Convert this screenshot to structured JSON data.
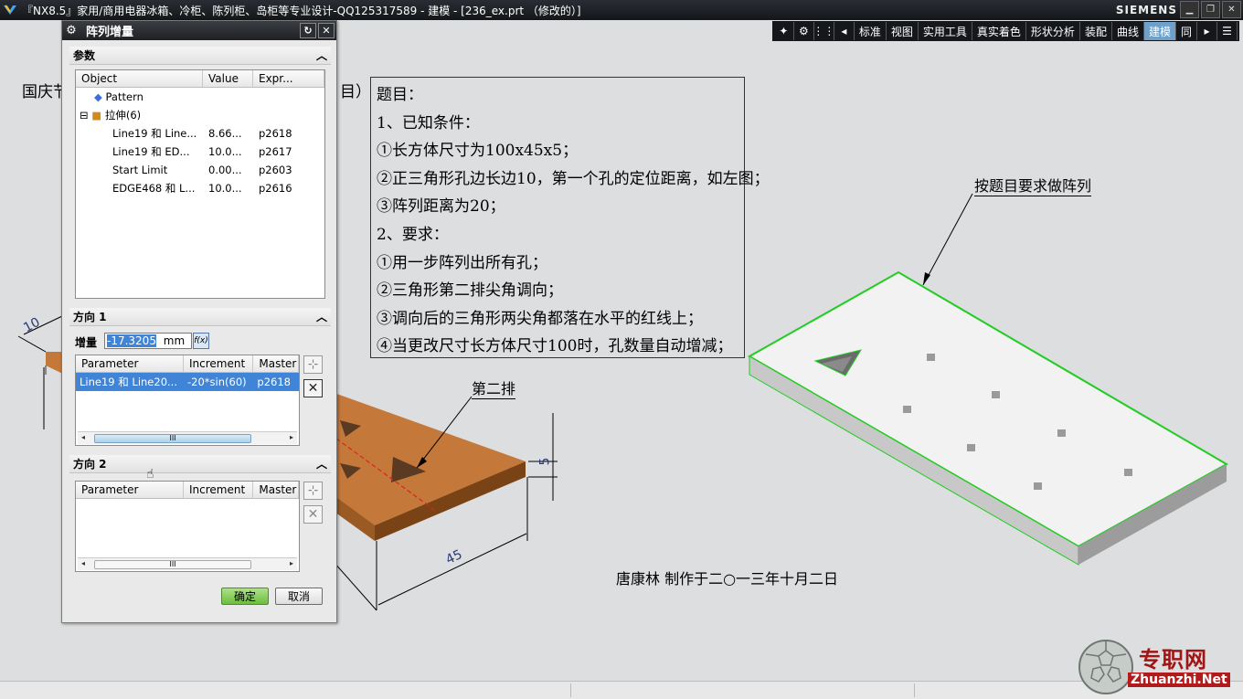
{
  "window": {
    "title": "『NX8.5』家用/商用电器冰箱、冷柜、陈列柜、岛柜等专业设计-QQ125317589 - 建模 - [236_ex.prt （修改的）]",
    "brand": "SIEMENS",
    "min": "▁",
    "restore": "❐",
    "close": "✕"
  },
  "toolbar": {
    "items": [
      "标准",
      "视图",
      "实用工具",
      "真实着色",
      "形状分析",
      "装配",
      "曲线",
      "建模",
      "同"
    ],
    "active": "建模"
  },
  "dialog": {
    "title": "阵列增量",
    "reset": "↻",
    "close": "✕",
    "params_label": "参数",
    "grid1": {
      "headers": [
        "Object",
        "Value",
        "Expr..."
      ],
      "rows": [
        {
          "object": "Pattern",
          "value": "",
          "expr": ""
        },
        {
          "object": "拉伸(6)",
          "value": "",
          "expr": ""
        },
        {
          "object": "Line19 和 Line...",
          "value": "8.66...",
          "expr": "p2618"
        },
        {
          "object": "Line19 和 ED...",
          "value": "10.0...",
          "expr": "p2617"
        },
        {
          "object": "Start Limit",
          "value": "0.00...",
          "expr": "p2603"
        },
        {
          "object": "EDGE468 和 L...",
          "value": "10.0...",
          "expr": "p2616"
        }
      ]
    },
    "dir1": {
      "label": "方向 1",
      "incr_label": "增量",
      "incr_value": "-17.3205",
      "incr_unit": "mm",
      "fx": "f(x)",
      "headers": [
        "Parameter",
        "Increment",
        "Master"
      ],
      "row": {
        "param": "Line19 和 Line20...",
        "incr": "-20*sin(60)",
        "master": "p2618"
      }
    },
    "dir2": {
      "label": "方向 2",
      "headers": [
        "Parameter",
        "Increment",
        "Master"
      ]
    },
    "scroll_thumb": "III",
    "ok": "确定",
    "cancel": "取消"
  },
  "canvas": {
    "heading_left": "国庆节",
    "heading_right": "目）",
    "note_lines": [
      "题目：",
      "1、已知条件：",
      "①长方体尺寸为100x45x5；",
      "②正三角形孔边长边10，第一个孔的定位距离，如左图；",
      "③阵列距离为20；",
      "2、要求：",
      "①用一步阵列出所有孔；",
      "②三角形第二排尖角调向；",
      "③调向后的三角形两尖角都落在水平的红线上；",
      "④当更改尺寸长方体尺寸100时，孔数量自动增减；"
    ],
    "label_second_row": "第二排",
    "label_make_pattern": "按题目要求做阵列",
    "credit": "唐康林  制作于二○一三年十月二日",
    "dim_10": "10",
    "dim_5": "5",
    "dim_45": "45"
  },
  "watermark": {
    "cn": "专职网",
    "en": "Zhuanzhi.Net"
  },
  "colors": {
    "plate": "#c4783a",
    "plate_side": "#8a4e1c",
    "green_edge": "#33dd33",
    "selection": "#3f84d6"
  }
}
